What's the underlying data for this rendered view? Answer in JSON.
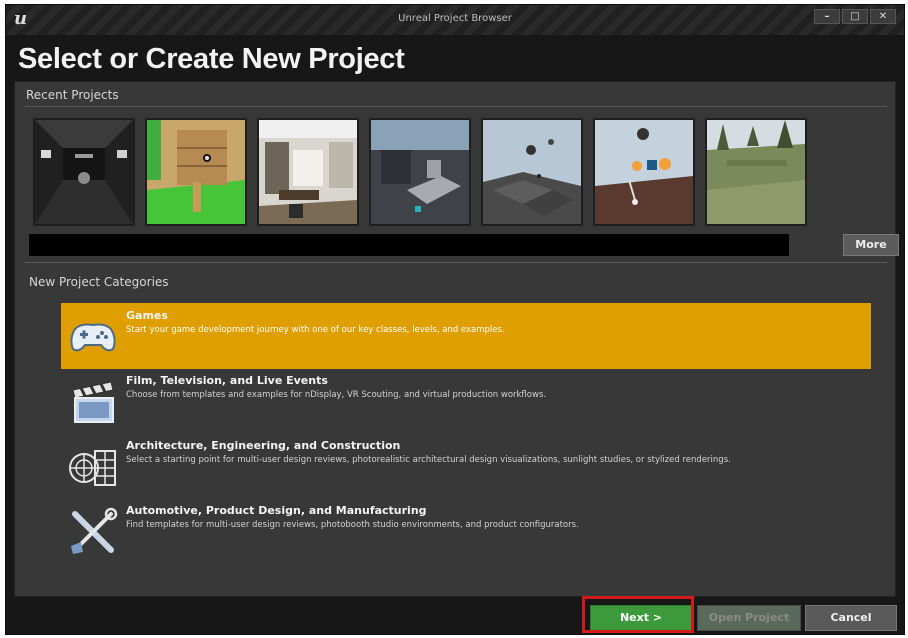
{
  "window": {
    "title": "Unreal Project Browser",
    "logo_text": "u",
    "controls": [
      "–",
      "□",
      "✕"
    ]
  },
  "main_title": "Select or Create New Project",
  "recent": {
    "label": "Recent Projects",
    "more_label": "More",
    "thumbnails": [
      "thumbnail-1",
      "thumbnail-2",
      "thumbnail-3",
      "thumbnail-4",
      "thumbnail-5",
      "thumbnail-6",
      "thumbnail-7"
    ]
  },
  "categories": {
    "label": "New Project Categories",
    "items": [
      {
        "title": "Games",
        "description": "Start your game development journey with one of our key classes, levels, and examples.",
        "icon": "gamepad-icon",
        "selected": true
      },
      {
        "title": "Film, Television, and Live Events",
        "description": "Choose from templates and examples for nDisplay, VR Scouting, and virtual production workflows.",
        "icon": "clapperboard-icon",
        "selected": false
      },
      {
        "title": "Architecture, Engineering, and Construction",
        "description": "Select a starting point for multi-user design reviews, photorealistic architectural design visualizations, sunlight studies, or stylized renderings.",
        "icon": "building-icon",
        "selected": false
      },
      {
        "title": "Automotive, Product Design, and Manufacturing",
        "description": "Find templates for multi-user design reviews, photobooth studio environments, and product configurators.",
        "icon": "tools-icon",
        "selected": false
      }
    ]
  },
  "footer": {
    "next_label": "Next >",
    "open_label": "Open Project",
    "cancel_label": "Cancel"
  },
  "colors": {
    "accent": "#e09f00",
    "next": "#3c9a3c",
    "highlight": "#d11a1a"
  }
}
